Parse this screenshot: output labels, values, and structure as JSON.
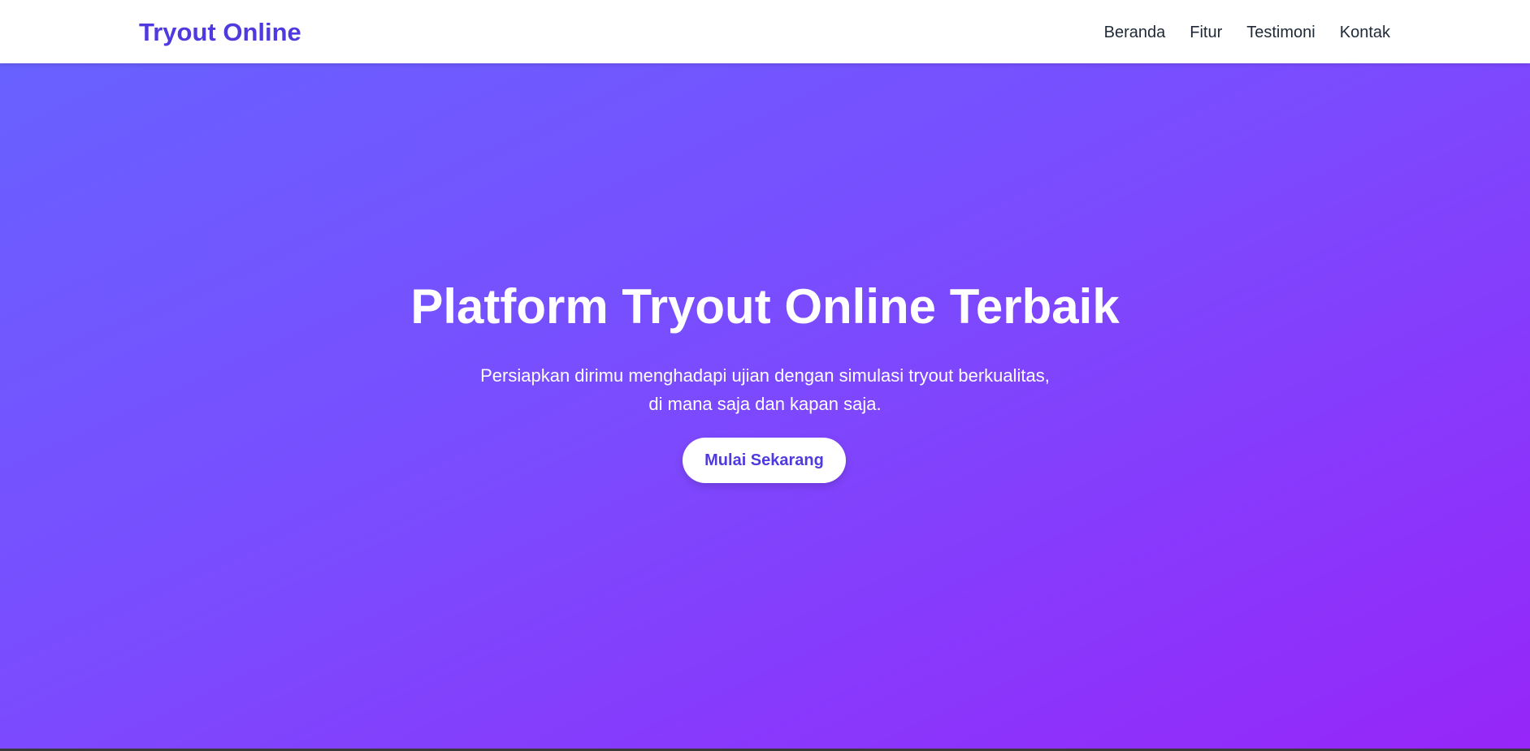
{
  "navbar": {
    "brand": "Tryout Online",
    "links": [
      "Beranda",
      "Fitur",
      "Testimoni",
      "Kontak"
    ]
  },
  "hero": {
    "title": "Platform Tryout Online Terbaik",
    "subtitle_line1": "Persiapkan dirimu menghadapi ujian dengan simulasi tryout berkualitas,",
    "subtitle_line2": "di mana saja dan kapan saja.",
    "cta_label": "Mulai Sekarang"
  },
  "colors": {
    "brand": "#4f3ae0",
    "gradient_start": "#6861ff",
    "gradient_end": "#9626f9",
    "nav_text": "#1f2937"
  }
}
